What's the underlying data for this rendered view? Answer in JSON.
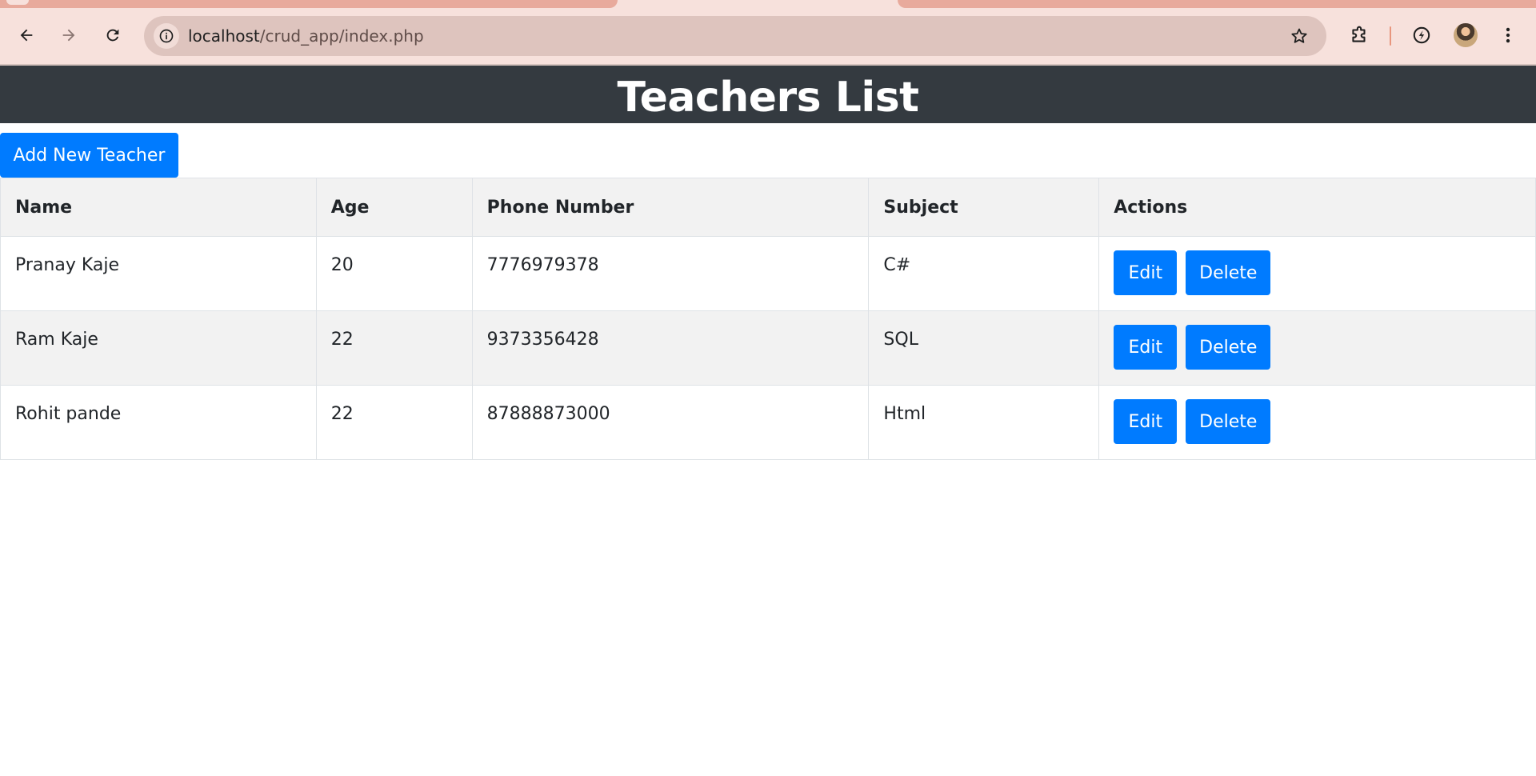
{
  "browser": {
    "url_host": "localhost",
    "url_path": "/crud_app/index.php",
    "icons": {
      "back": "arrow-left-icon",
      "forward": "arrow-right-icon",
      "reload": "reload-icon",
      "site_info": "info-icon",
      "bookmark": "star-icon",
      "extensions": "puzzle-icon",
      "performance": "performance-icon",
      "profile": "avatar",
      "menu": "kebab-menu-icon"
    },
    "colors": {
      "frame": "#f7e1dc",
      "omnibox": "#dec4be",
      "tab": "#e8aa9c"
    }
  },
  "page": {
    "title": "Teachers List",
    "add_button_label": "Add New Teacher",
    "colors": {
      "header_bg": "#343a40",
      "primary": "#007bff",
      "stripe": "#f2f2f2"
    }
  },
  "table": {
    "headers": [
      "Name",
      "Age",
      "Phone Number",
      "Subject",
      "Actions"
    ],
    "rows": [
      {
        "name": "Pranay Kaje",
        "age": "20",
        "phone": "7776979378",
        "subject": "C#"
      },
      {
        "name": "Ram Kaje",
        "age": "22",
        "phone": "9373356428",
        "subject": "SQL"
      },
      {
        "name": "Rohit pande",
        "age": "22",
        "phone": "87888873000",
        "subject": "Html"
      }
    ],
    "edit_label": "Edit",
    "delete_label": "Delete"
  }
}
